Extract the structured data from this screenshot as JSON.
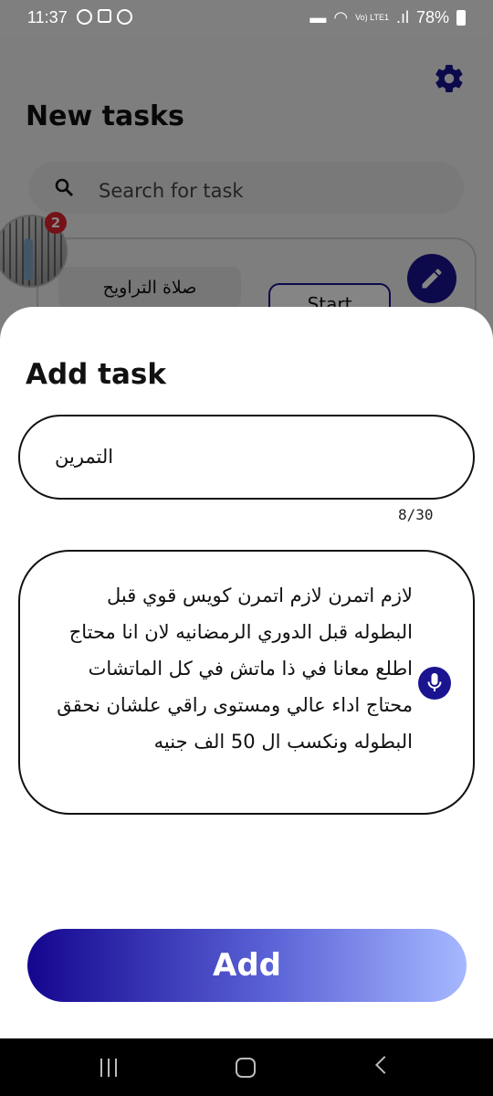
{
  "status_bar": {
    "time": "11:37",
    "network": "Vo) LTE1",
    "battery": "78%"
  },
  "background_screen": {
    "title": "New tasks",
    "search": {
      "placeholder": "Search for task"
    },
    "notification_badge": "2",
    "task": {
      "name": "صلاة التراويح",
      "start_label": "Start"
    }
  },
  "sheet": {
    "title": "Add task",
    "task_name_value": "التمرين",
    "char_counter": "8/30",
    "description_value": "لازم اتمرن لازم اتمرن كويس قوي قبل البطوله قبل الدوري الرمضانيه لان انا محتاج اطلع معانا في ذا ماتش في كل الماتشات محتاج اداء عالي ومستوى راقي علشان نحقق البطوله ونكسب ال 50 الف جنيه",
    "add_label": "Add"
  },
  "colors": {
    "accent": "#1a1490",
    "badge": "#e0242e",
    "add_gradient_start": "#14068f",
    "add_gradient_end": "#a6b8ff"
  },
  "icons": [
    "gear-icon",
    "search-icon",
    "edit-icon",
    "microphone-icon",
    "recent-apps-icon",
    "home-icon",
    "back-icon"
  ]
}
